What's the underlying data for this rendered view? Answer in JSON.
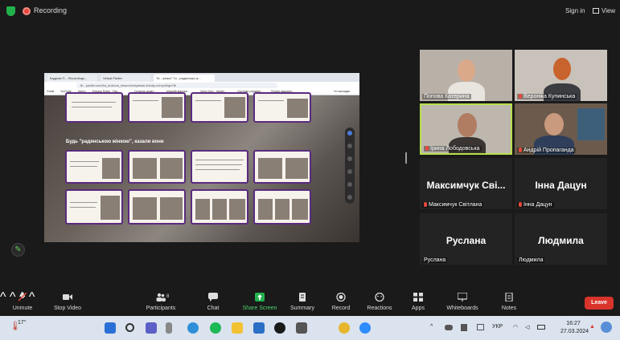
{
  "topbar": {
    "recording_label": "Recording",
    "signin_label": "Sign in",
    "view_label": "View"
  },
  "share": {
    "browser_tabs": [
      "Кадрові П... Recordings...",
      "Virtual Padlet",
      "Ти - жінка? Ти - радянська ж..."
    ],
    "address": "fb - padlet.com/ira_kozlova_leisure/radyanski-zhinky-m4vyht2gb7fb",
    "bookmarks": [
      "Gmail",
      "YouTube",
      "Карти",
      "Edward Robin · Pap...",
      "Останнє оновл...",
      "Мовний відрізок...",
      "Хата Хоти - Україн...",
      "Система управлін...",
      "Проект відкрито...",
      "Усі закладки"
    ],
    "heading": "Будь \"радянською жінкою\", казали вони"
  },
  "tiles": [
    {
      "name": "Попова Катерина",
      "muted": false
    },
    {
      "name": "Вероніка Купинська",
      "muted": true
    },
    {
      "name": "Ірина Лободовська",
      "muted": true
    },
    {
      "name": "Андрій Пропаганда",
      "muted": true
    },
    {
      "big": "Максимчук Сві...",
      "name": "Максимчук Світлана",
      "muted": true
    },
    {
      "big": "Інна Дацун",
      "name": "Інна Дацун",
      "muted": true
    },
    {
      "big": "Руслана",
      "name": "Руслана",
      "muted": false
    },
    {
      "big": "Людмила",
      "name": "Людмила",
      "muted": false
    }
  ],
  "toolbar": {
    "unmute": "Unmute",
    "stop_video": "Stop Video",
    "participants": "Participants",
    "participants_count": "8",
    "chat": "Chat",
    "share_screen": "Share Screen",
    "summary": "Summary",
    "record": "Record",
    "reactions": "Reactions",
    "apps": "Apps",
    "whiteboards": "Whiteboards",
    "notes": "Notes",
    "leave": "Leave"
  },
  "taskbar": {
    "weather": "17°",
    "lang": "УКР",
    "time": "16:27",
    "date": "27.03.2024"
  },
  "colors": {
    "accent_green": "#22b24c",
    "record_red": "#e5483b",
    "leave_red": "#d9342b",
    "speaker_border": "#b8e04a",
    "padlet_purple": "#5a2b7e"
  }
}
